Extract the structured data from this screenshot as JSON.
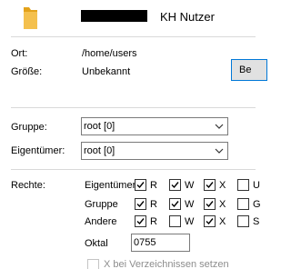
{
  "header": {
    "folder_name": "KH Nutzer"
  },
  "info": {
    "location_label": "Ort:",
    "location_value": "/home/users",
    "size_label": "Größe:",
    "size_value": "Unbekannt",
    "side_button_label": "Be"
  },
  "ownership": {
    "group_label": "Gruppe:",
    "group_value": "root [0]",
    "owner_label": "Eigentümer:",
    "owner_value": "root [0]"
  },
  "permissions": {
    "label": "Rechte:",
    "rows": [
      {
        "name": "Eigentümer",
        "r": true,
        "w": true,
        "x": true,
        "extra": false
      },
      {
        "name": "Gruppe",
        "r": true,
        "w": true,
        "x": true,
        "extra": false
      },
      {
        "name": "Andere",
        "r": true,
        "w": false,
        "x": true,
        "extra": false
      }
    ],
    "letters": {
      "r": "R",
      "w": "W",
      "x": "X"
    },
    "extra_letters": [
      "U",
      "G",
      "S"
    ],
    "octal_label": "Oktal",
    "octal_value": "0755",
    "dir_option_label": "X bei Verzeichnissen setzen",
    "dir_option_checked": false
  },
  "colors": {
    "focus_blue": "#0078d7",
    "folder_yellow": "#f4c04d",
    "separator": "#d9d9d9"
  }
}
